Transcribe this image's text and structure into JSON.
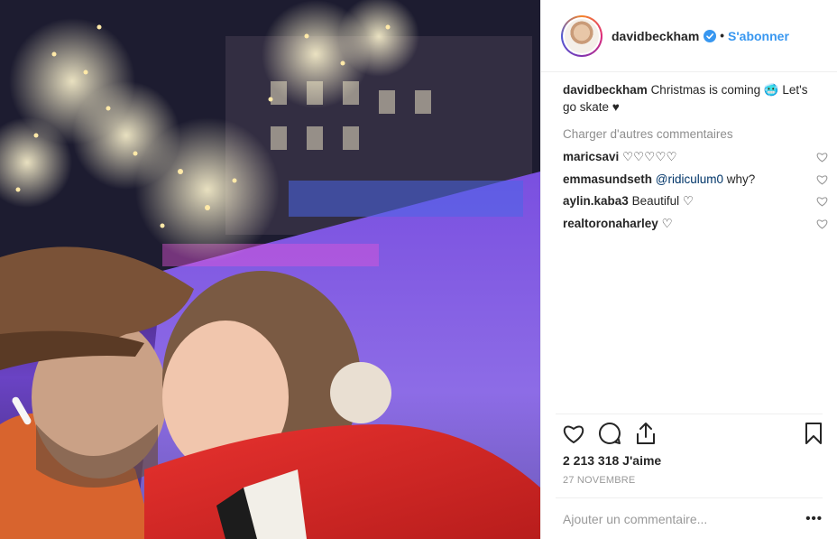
{
  "header": {
    "username": "davidbeckham",
    "separator": "•",
    "follow_label": "S'abonner"
  },
  "caption": {
    "username": "davidbeckham",
    "text": "Christmas is coming 🥶 Let's go skate ♥"
  },
  "load_more_label": "Charger d'autres commentaires",
  "comments": [
    {
      "username": "maricsavi",
      "text": "♡♡♡♡♡"
    },
    {
      "username": "emmasundseth",
      "mention": "@ridiculum0",
      "text": "why?"
    },
    {
      "username": "aylin.kaba3",
      "text": "Beautiful ♡"
    },
    {
      "username": "realtoronaharley",
      "text": "♡"
    }
  ],
  "likes": "2 213 318 J'aime",
  "date": "27 NOVEMBRE",
  "add_comment_placeholder": "Ajouter un commentaire...",
  "more_options": "•••",
  "icons": {
    "verified": "verified-badge-icon",
    "like": "heart-icon",
    "comment": "comment-icon",
    "share": "share-icon",
    "save": "bookmark-icon"
  },
  "colors": {
    "accent": "#3897f0",
    "muted": "#8e8e8e",
    "mention": "#003569"
  }
}
